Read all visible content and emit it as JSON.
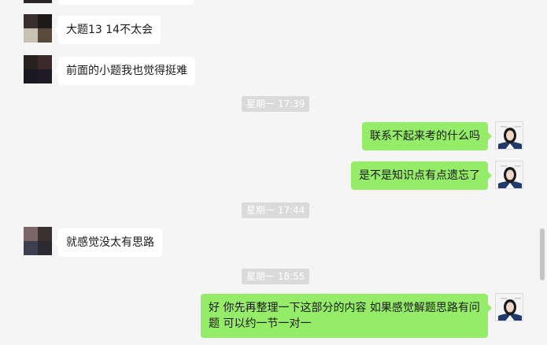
{
  "messages": [
    {
      "side": "in",
      "text": "大题13 14不太会"
    },
    {
      "side": "in",
      "text": "前面的小题我也觉得挺难"
    },
    {
      "type": "time",
      "text": "星期一 17:39"
    },
    {
      "side": "out",
      "text": "联系不起来考的什么吗"
    },
    {
      "side": "out",
      "text": "是不是知识点有点遗忘了"
    },
    {
      "type": "time",
      "text": "星期一 17:44"
    },
    {
      "side": "in",
      "text": "就感觉没太有思路"
    },
    {
      "type": "time",
      "text": "星期一 18:55"
    },
    {
      "side": "out",
      "text": "好 你先再整理一下这部分的内容 如果感觉解题思路有问题 可以约一节一对一"
    }
  ],
  "avatar_colors": {
    "contact_1": [
      "#3a2e2e",
      "#1e1a1a",
      "#c8c2b3",
      "#5a4a3a"
    ],
    "contact_2": [
      "#2a2222",
      "#3a2a2a",
      "#1a1820",
      "#1e1a26"
    ],
    "contact_3": [
      "#7a6666",
      "#3a3030",
      "#3a4050",
      "#2a2a30"
    ]
  },
  "colors": {
    "background": "#f5f5f5",
    "incoming_bubble": "#ffffff",
    "outgoing_bubble": "#95ec69",
    "timestamp_bg": "#dadada"
  },
  "icons": [
    "contact-avatar",
    "self-avatar"
  ]
}
